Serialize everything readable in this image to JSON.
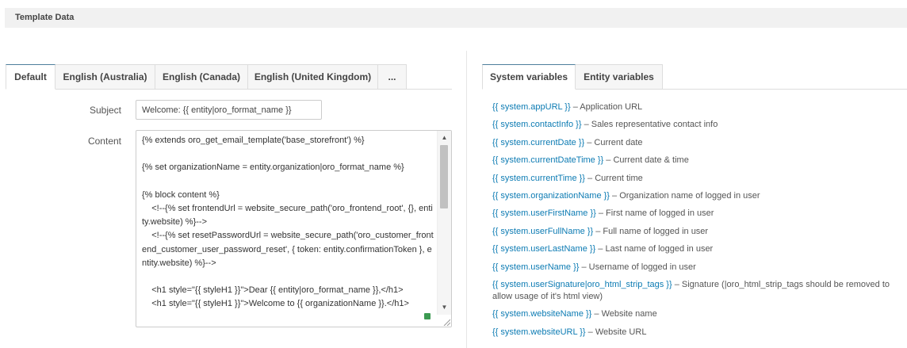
{
  "section": {
    "title": "Template Data"
  },
  "locale_tabs": [
    {
      "label": "Default",
      "active": true
    },
    {
      "label": "English (Australia)",
      "active": false
    },
    {
      "label": "English (Canada)",
      "active": false
    },
    {
      "label": "English (United Kingdom)",
      "active": false
    },
    {
      "label": "...",
      "active": false
    }
  ],
  "form": {
    "subject_label": "Subject",
    "subject_value": "Welcome: {{ entity|oro_format_name }}",
    "content_label": "Content",
    "content_lines": [
      "{% extends oro_get_email_template('base_storefront') %}",
      "",
      "{% set organizationName = entity.organization|oro_format_name %}",
      "",
      "{% block content %}",
      "    <!--{% set frontendUrl = website_secure_path('oro_frontend_root', {}, entity.website) %}-->",
      "    <!--{% set resetPasswordUrl = website_secure_path('oro_customer_frontend_customer_user_password_reset', { token: entity.confirmationToken }, entity.website) %}-->",
      "",
      "    <h1 style=\"{{ styleH1 }}\">Dear {{ entity|oro_format_name }},</h1>",
      "    <h1 style=\"{{ styleH1 }}\">Welcome to {{ organizationName }}.</h1>"
    ],
    "scroll_up_glyph": "▲",
    "scroll_down_glyph": "▼"
  },
  "variable_tabs": [
    {
      "label": "System variables",
      "active": true
    },
    {
      "label": "Entity variables",
      "active": false
    }
  ],
  "system_variables": [
    {
      "token": "{{ system.appURL }}",
      "description": " – Application URL"
    },
    {
      "token": "{{ system.contactInfo }}",
      "description": " – Sales representative contact info"
    },
    {
      "token": "{{ system.currentDate }}",
      "description": " – Current date"
    },
    {
      "token": "{{ system.currentDateTime }}",
      "description": " – Current date & time"
    },
    {
      "token": "{{ system.currentTime }}",
      "description": " – Current time"
    },
    {
      "token": "{{ system.organizationName }}",
      "description": " – Organization name of logged in user"
    },
    {
      "token": "{{ system.userFirstName }}",
      "description": " – First name of logged in user"
    },
    {
      "token": "{{ system.userFullName }}",
      "description": " – Full name of logged in user"
    },
    {
      "token": "{{ system.userLastName }}",
      "description": " – Last name of logged in user"
    },
    {
      "token": "{{ system.userName }}",
      "description": " – Username of logged in user"
    },
    {
      "token": "{{ system.userSignature|oro_html_strip_tags }}",
      "description": " – Signature (|oro_html_strip_tags should be removed to allow usage of it's html view)"
    },
    {
      "token": "{{ system.websiteName }}",
      "description": " – Website name"
    },
    {
      "token": "{{ system.websiteURL }}",
      "description": " – Website URL"
    }
  ]
}
